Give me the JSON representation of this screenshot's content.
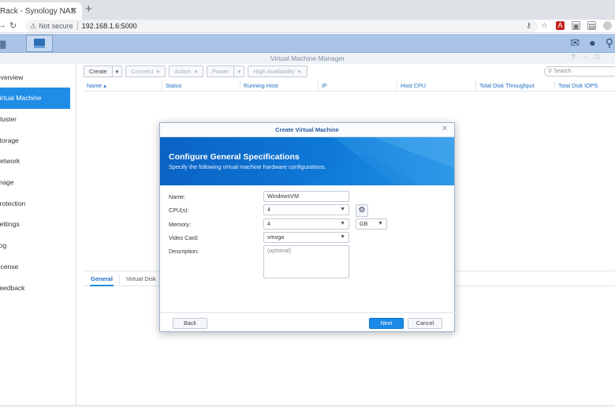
{
  "browser": {
    "tab_title": "Rack - Synology NAS",
    "tab_close": "✕",
    "new_tab": "+",
    "security_label": "Not secure",
    "url": "192.168.1.6:5000"
  },
  "app": {
    "window_title": "Virtual Machine Manager"
  },
  "sidebar": {
    "items": [
      {
        "label": "Overview"
      },
      {
        "label": "Virtual Machine"
      },
      {
        "label": "Cluster"
      },
      {
        "label": "Storage"
      },
      {
        "label": "Network"
      },
      {
        "label": "Image"
      },
      {
        "label": "Protection"
      },
      {
        "label": "Settings"
      },
      {
        "label": "Log"
      },
      {
        "label": "License"
      },
      {
        "label": "Feedback"
      }
    ],
    "active_index": 1
  },
  "toolbar": {
    "create": "Create",
    "connect": "Connect",
    "action": "Action",
    "power": "Power",
    "high_availability": "High Availability",
    "search_placeholder": "Search"
  },
  "table": {
    "columns": [
      "Name",
      "Status",
      "Running Host",
      "IP",
      "Host CPU",
      "Total Disk Throughput",
      "Total Disk IOPS"
    ],
    "sort_indicator": "▴"
  },
  "bottom_tabs": {
    "general": "General",
    "virtual_disk": "Virtual Disk"
  },
  "dialog": {
    "title": "Create Virtual Machine",
    "heading": "Configure General Specifications",
    "subheading": "Specify the following virtual machine hardware configurations.",
    "fields": {
      "name_label": "Name:",
      "name_value": "WindowsVM",
      "cpu_label": "CPU(s):",
      "cpu_value": "4",
      "memory_label": "Memory:",
      "memory_value": "4",
      "memory_unit": "GB",
      "video_label": "Video Card:",
      "video_value": "vmvga",
      "description_label": "Description:",
      "description_placeholder": "(optional)"
    },
    "buttons": {
      "back": "Back",
      "next": "Next",
      "cancel": "Cancel"
    }
  },
  "colors": {
    "accent": "#1f8ce6",
    "banner": "#0f7ad8",
    "dsm_bar": "#a9c4e6"
  }
}
